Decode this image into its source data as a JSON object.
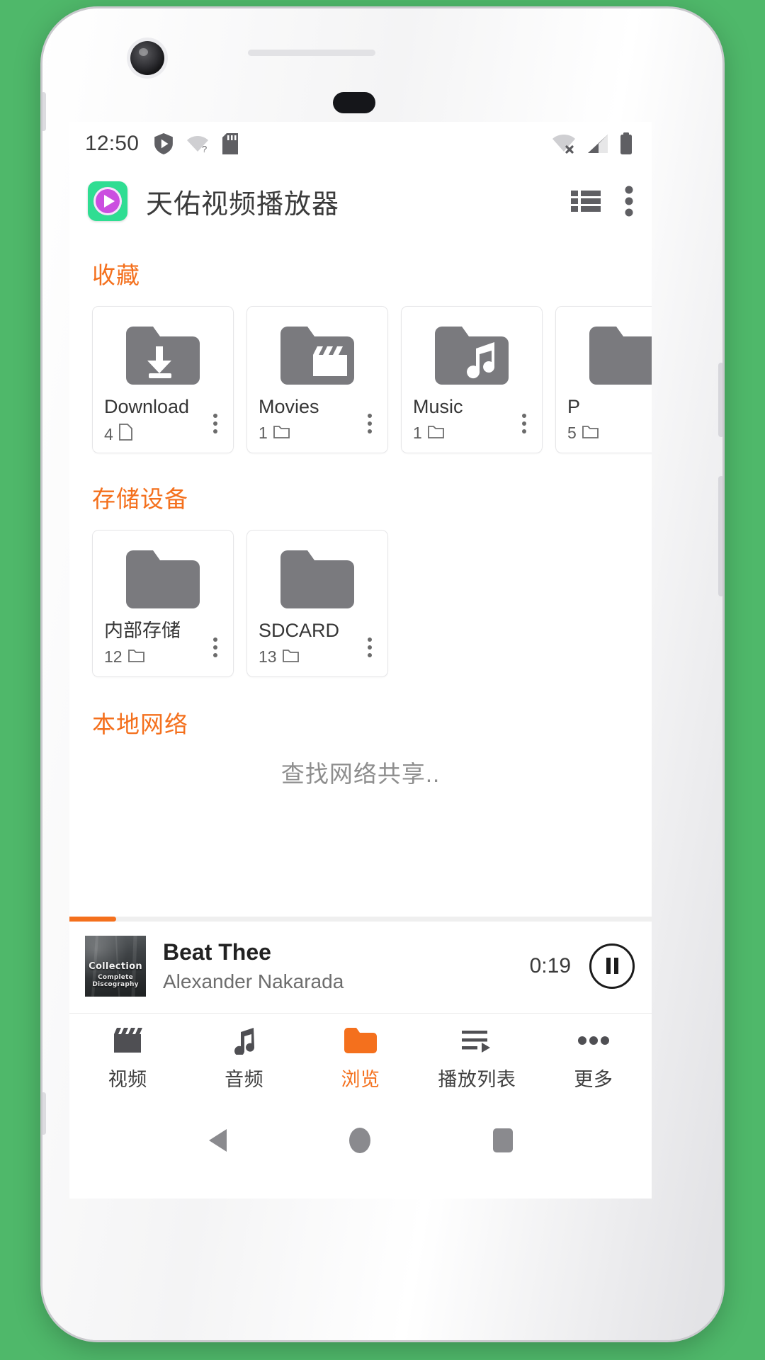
{
  "status_bar": {
    "time": "12:50",
    "left_icons": [
      "shield-play-icon",
      "wifi-question-icon",
      "sdcard-icon"
    ],
    "right_icons": [
      "wifi-off-icon",
      "signal-icon",
      "battery-icon"
    ]
  },
  "app_bar": {
    "icon": "app-logo-icon",
    "title": "天佑视频播放器",
    "list_view_icon": "list-view-icon",
    "overflow_icon": "overflow-menu-icon"
  },
  "sections": {
    "favorites": {
      "title": "收藏",
      "cards": [
        {
          "name": "Download",
          "count": "4",
          "count_icon": "file-icon",
          "folder_icon": "folder-download-icon"
        },
        {
          "name": "Movies",
          "count": "1",
          "count_icon": "folder-icon",
          "folder_icon": "folder-movies-icon"
        },
        {
          "name": "Music",
          "count": "1",
          "count_icon": "folder-icon",
          "folder_icon": "folder-music-icon"
        },
        {
          "name": "P",
          "count": "5",
          "count_icon": "folder-icon",
          "folder_icon": "folder-icon"
        }
      ]
    },
    "storage": {
      "title": "存储设备",
      "cards": [
        {
          "name": "内部存储",
          "count": "12",
          "count_icon": "folder-icon",
          "folder_icon": "folder-icon"
        },
        {
          "name": "SDCARD",
          "count": "13",
          "count_icon": "folder-icon",
          "folder_icon": "folder-icon"
        }
      ]
    },
    "network": {
      "title": "本地网络",
      "message": "查找网络共享.."
    }
  },
  "now_playing": {
    "album_art_title": "Collection",
    "album_art_subtitle": "Complete Discography",
    "track_title": "Beat Thee",
    "artist": "Alexander Nakarada",
    "elapsed": "0:19",
    "progress_percent": 8,
    "playpause_icon": "pause-icon"
  },
  "bottom_nav": {
    "items": [
      {
        "label": "视频",
        "icon": "clapperboard-icon",
        "active": false
      },
      {
        "label": "音频",
        "icon": "music-note-icon",
        "active": false
      },
      {
        "label": "浏览",
        "icon": "folder-filled-icon",
        "active": true
      },
      {
        "label": "播放列表",
        "icon": "playlist-icon",
        "active": false
      },
      {
        "label": "更多",
        "icon": "more-dots-icon",
        "active": false
      }
    ]
  },
  "android_nav": {
    "back": "back-triangle-icon",
    "home": "home-circle-icon",
    "recents": "recents-square-icon"
  },
  "colors": {
    "accent": "#f4701d",
    "icon_gray": "#6f6f73",
    "app_icon_bg": "#2fdd92",
    "app_icon_disc": "#cb4ee0"
  }
}
